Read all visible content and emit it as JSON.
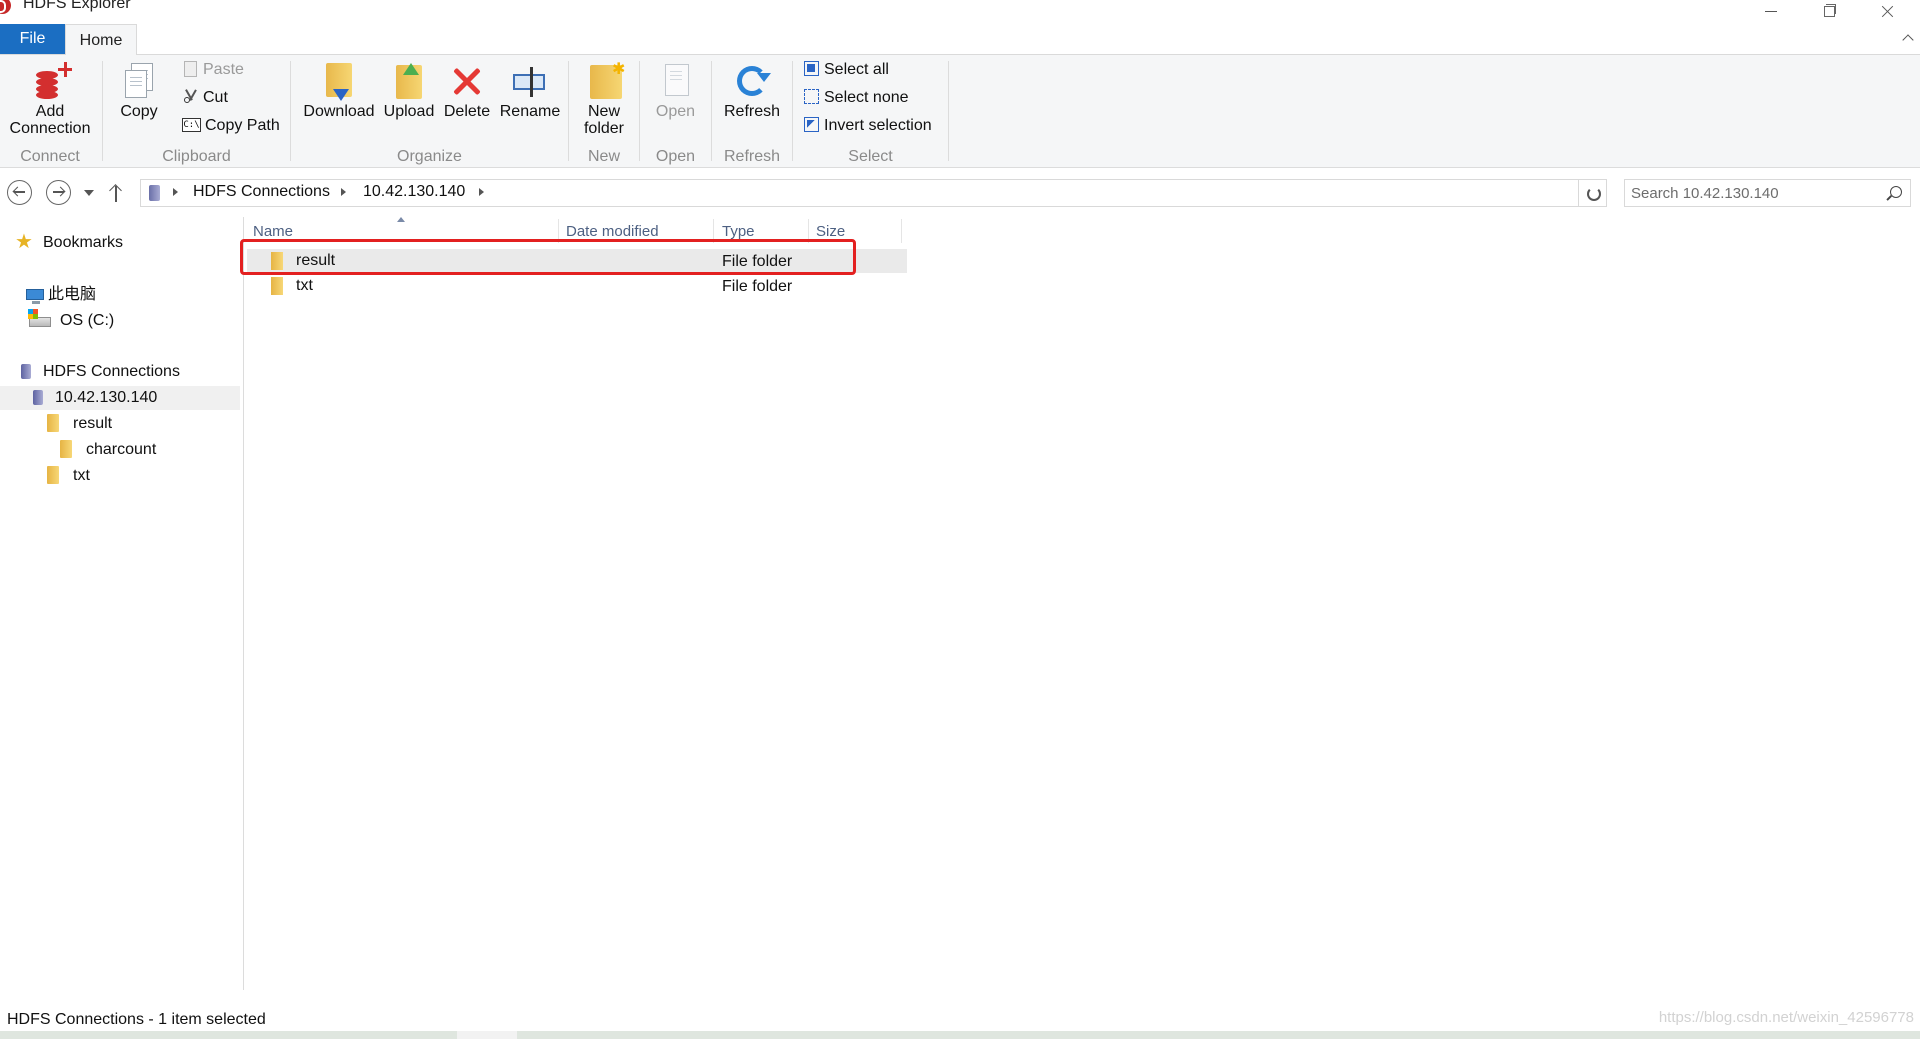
{
  "window": {
    "title": "HDFS Explorer"
  },
  "tabs": {
    "file": "File",
    "home": "Home"
  },
  "ribbon": {
    "connect": {
      "add_connection": "Add\nConnection",
      "group": "Connect"
    },
    "clipboard": {
      "copy": "Copy",
      "paste": "Paste",
      "cut": "Cut",
      "copy_path": "Copy Path",
      "group": "Clipboard"
    },
    "organize": {
      "download": "Download",
      "upload": "Upload",
      "delete": "Delete",
      "rename": "Rename",
      "group": "Organize"
    },
    "new": {
      "new_folder": "New\nfolder",
      "group": "New"
    },
    "open": {
      "open": "Open",
      "group": "Open"
    },
    "refresh": {
      "refresh": "Refresh",
      "group": "Refresh"
    },
    "select": {
      "select_all": "Select all",
      "select_none": "Select none",
      "invert_selection": "Invert selection",
      "group": "Select"
    }
  },
  "address": {
    "crumbs": [
      "HDFS Connections",
      "10.42.130.140"
    ],
    "search_placeholder": "Search 10.42.130.140"
  },
  "sidebar": {
    "bookmarks": "Bookmarks",
    "this_pc": "此电脑",
    "os_drive": "OS (C:)",
    "hdfs_connections": "HDFS Connections",
    "host": "10.42.130.140",
    "folders": [
      "result",
      "charcount",
      "txt"
    ]
  },
  "filelist": {
    "columns": [
      "Name",
      "Date modified",
      "Type",
      "Size"
    ],
    "rows": [
      {
        "name": "result",
        "date": "",
        "type": "File folder",
        "size": ""
      },
      {
        "name": "txt",
        "date": "",
        "type": "File folder",
        "size": ""
      }
    ]
  },
  "status": {
    "text": "HDFS Connections - 1 item selected",
    "watermark": "https://blog.csdn.net/weixin_42596778"
  },
  "colors": {
    "accent": "#1b6ec2",
    "highlight": "#e32020",
    "folder": "#f0c65a"
  }
}
